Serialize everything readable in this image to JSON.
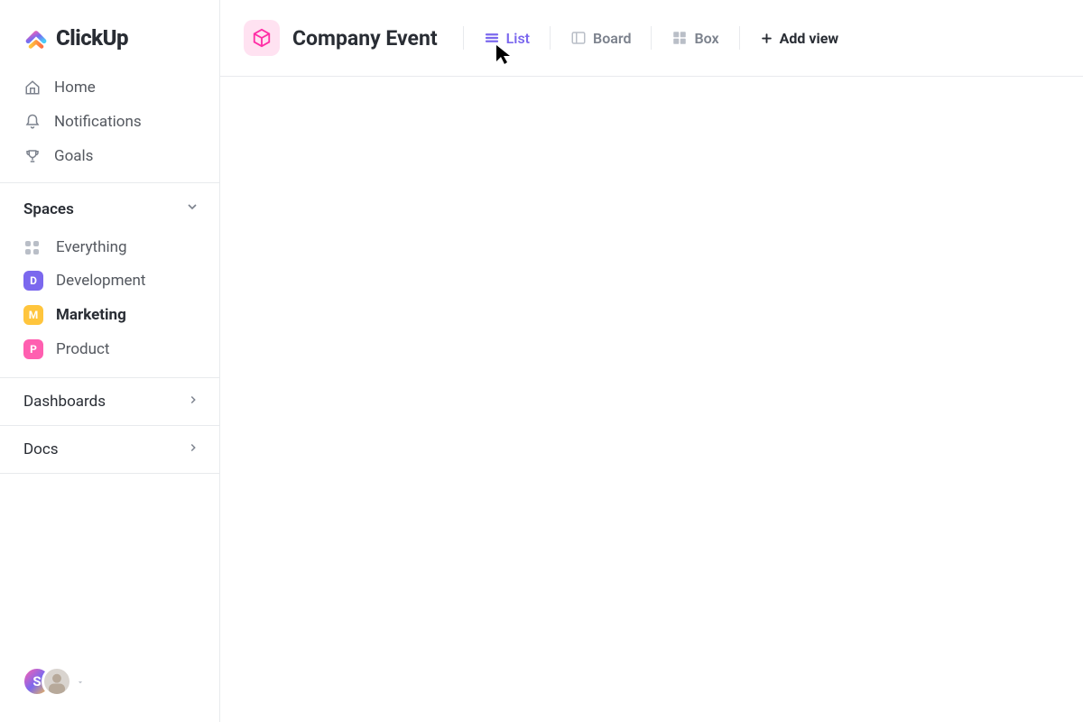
{
  "brand": "ClickUp",
  "nav": {
    "home": "Home",
    "notifications": "Notifications",
    "goals": "Goals"
  },
  "spaces_section": {
    "title": "Spaces",
    "everything": "Everything",
    "items": [
      {
        "letter": "D",
        "label": "Development"
      },
      {
        "letter": "M",
        "label": "Marketing"
      },
      {
        "letter": "P",
        "label": "Product"
      }
    ]
  },
  "sections": {
    "dashboards": "Dashboards",
    "docs": "Docs"
  },
  "header": {
    "title": "Company Event",
    "views": {
      "list": "List",
      "board": "Board",
      "box": "Box",
      "add": "Add view"
    }
  },
  "user_initial": "S"
}
